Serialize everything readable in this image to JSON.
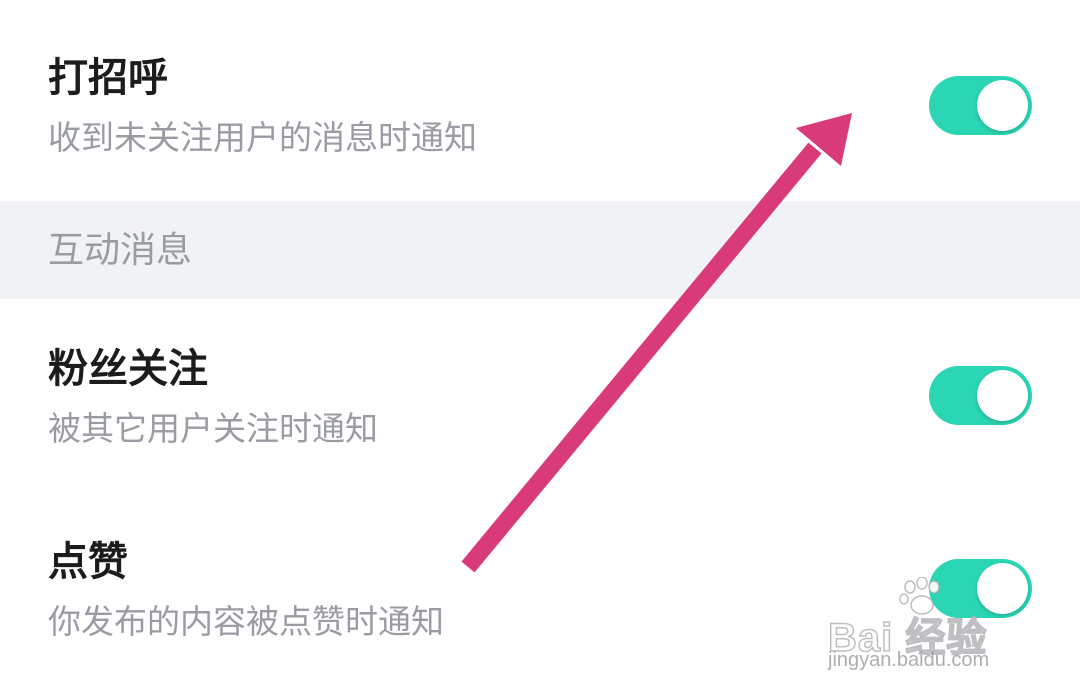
{
  "colors": {
    "toggle_on": "#2ad6b4",
    "arrow": "#d93a78",
    "section_bg": "#f1f2f5",
    "title_text": "#1c1c1e",
    "desc_text": "#9a9ca3"
  },
  "settings": [
    {
      "title": "打招呼",
      "description": "收到未关注用户的消息时通知",
      "enabled": true
    },
    {
      "title": "粉丝关注",
      "description": "被其它用户关注时通知",
      "enabled": true
    },
    {
      "title": "点赞",
      "description": "你发布的内容被点赞时通知",
      "enabled": true
    }
  ],
  "section": {
    "label": "互动消息"
  },
  "annotation": {
    "type": "arrow",
    "points_to": "greet-toggle"
  },
  "watermark": {
    "brand": "Bai 经验",
    "url": "jingyan.baidu.com",
    "icon": "baidu-paw-icon"
  }
}
